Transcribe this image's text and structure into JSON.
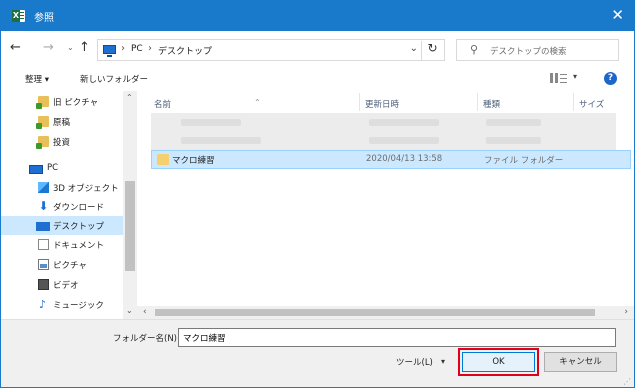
{
  "window": {
    "title": "参照",
    "app_icon": "excel-icon",
    "close_glyph": "✕"
  },
  "navigation": {
    "back_glyph": "←",
    "forward_glyph": "→",
    "recent_glyph": "⌄",
    "up_glyph": "↑",
    "address": [
      "PC",
      "デスクトップ"
    ],
    "address_sep": "›",
    "address_dropdown": "⌄",
    "refresh_glyph": "↻",
    "search_placeholder": "デスクトップの検索"
  },
  "commands": {
    "organize": "整理 ▾",
    "new_folder": "新しいフォルダー",
    "view_dropdown": "▾",
    "help": "?"
  },
  "sidebar": {
    "items": [
      {
        "label": "旧 ピクチャ",
        "icon": "folder-icon"
      },
      {
        "label": "原稿",
        "icon": "folder-icon"
      },
      {
        "label": "投資",
        "icon": "folder-icon"
      },
      {
        "label": "PC",
        "icon": "pc-icon"
      },
      {
        "label": "3D オブジェクト",
        "icon": "3d-objects-icon"
      },
      {
        "label": "ダウンロード",
        "icon": "download-icon"
      },
      {
        "label": "デスクトップ",
        "icon": "desktop-icon"
      },
      {
        "label": "ドキュメント",
        "icon": "documents-icon"
      },
      {
        "label": "ピクチャ",
        "icon": "pictures-icon"
      },
      {
        "label": "ビデオ",
        "icon": "videos-icon"
      },
      {
        "label": "ミュージック",
        "icon": "music-icon"
      }
    ],
    "selected": "デスクトップ"
  },
  "columns": {
    "name": "名前",
    "modified": "更新日時",
    "type": "種類",
    "size": "サイズ"
  },
  "files": [
    {
      "name": "マクロ練習",
      "modified": "2020/04/13 13:58",
      "type": "ファイル フォルダー",
      "selected": true
    }
  ],
  "footer": {
    "folder_name_label": "フォルダー名(N):",
    "folder_name_value": "マクロ練習",
    "tools_label": "ツール(L)",
    "tools_dropdown": "▾",
    "ok_label": "OK",
    "cancel_label": "キャンセル"
  },
  "colors": {
    "titlebar": "#1979ca",
    "selection": "#cce8ff",
    "highlight_box": "#e0001b"
  }
}
